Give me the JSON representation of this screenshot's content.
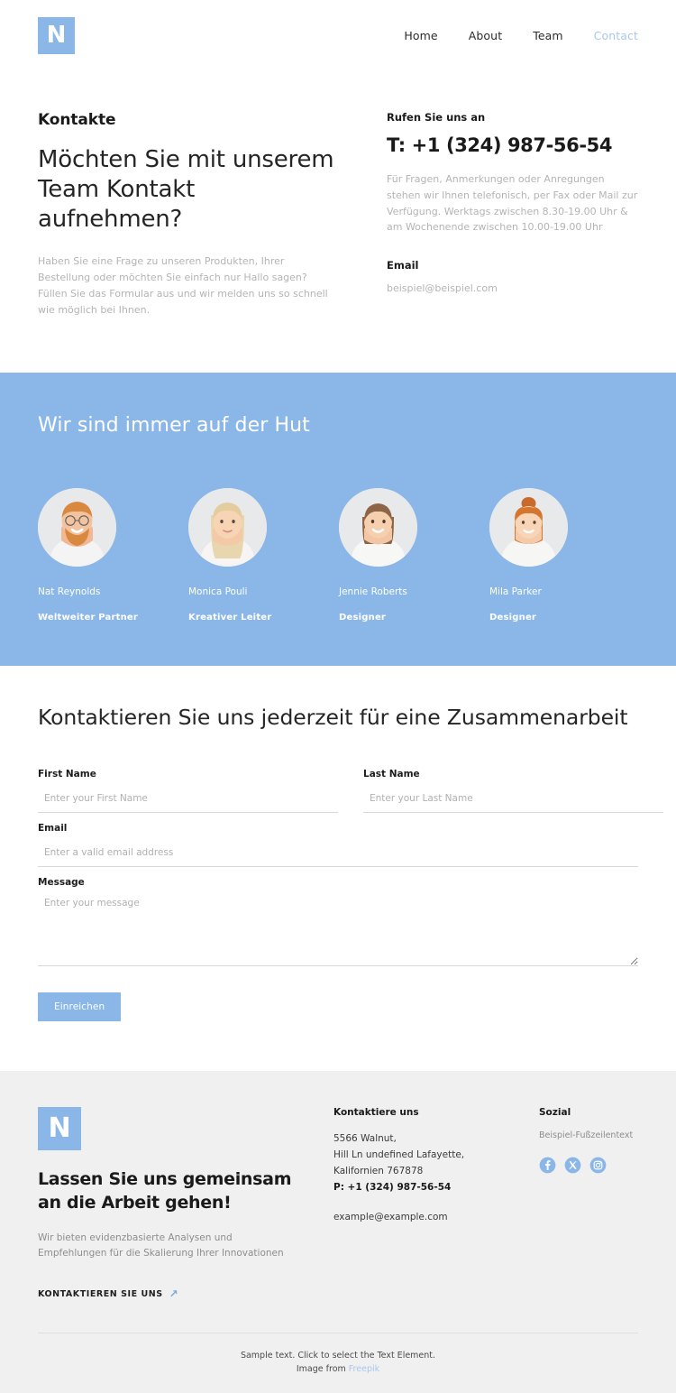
{
  "theme": {
    "accent": "#8ab7e8",
    "accent_light": "#a8c9ec",
    "footer_bg": "#f0f0f0",
    "muted": "#b4b4b4"
  },
  "header": {
    "logo_letter": "N",
    "nav": [
      {
        "label": "Home",
        "active": false
      },
      {
        "label": "About",
        "active": false
      },
      {
        "label": "Team",
        "active": false
      },
      {
        "label": "Contact",
        "active": true
      }
    ]
  },
  "intro": {
    "eyebrow": "Kontakte",
    "heading": "Möchten Sie mit unserem Team Kontakt aufnehmen?",
    "paragraph": "Haben Sie eine Frage zu unseren Produkten, Ihrer Bestellung oder möchten Sie einfach nur Hallo sagen? Füllen Sie das Formular aus und wir melden uns so schnell wie möglich bei Ihnen.",
    "call_label": "Rufen Sie uns an",
    "phone": "T: +1 (324) 987-56-54",
    "hours": "Für Fragen, Anmerkungen oder Anregungen stehen wir Ihnen telefonisch, per Fax oder Mail zur Verfügung. Werktags zwischen 8.30-19.00 Uhr & am Wochenende zwischen 10.00-19.00 Uhr",
    "email_label": "Email",
    "email": "beispiel@beispiel.com"
  },
  "team": {
    "title": "Wir sind immer auf der Hut",
    "members": [
      {
        "name": "Nat Reynolds",
        "role": "Weltweiter Partner"
      },
      {
        "name": "Monica Pouli",
        "role": "Kreativer Leiter"
      },
      {
        "name": "Jennie Roberts",
        "role": "Designer"
      },
      {
        "name": "Mila Parker",
        "role": "Designer"
      }
    ]
  },
  "form": {
    "title": "Kontaktieren Sie uns jederzeit für eine Zusammenarbeit",
    "first_name_label": "First Name",
    "first_name_placeholder": "Enter your First Name",
    "first_name_value": "",
    "last_name_label": "Last Name",
    "last_name_placeholder": "Enter your Last Name",
    "last_name_value": "",
    "email_label": "Email",
    "email_placeholder": "Enter a valid email address",
    "email_value": "",
    "message_label": "Message",
    "message_placeholder": "Enter your message",
    "message_value": "",
    "submit_label": "Einreichen"
  },
  "footer": {
    "logo_letter": "N",
    "heading": "Lassen Sie uns gemeinsam an die Arbeit gehen!",
    "subtext": "Wir bieten evidenzbasierte Analysen und Empfehlungen für die Skalierung Ihrer Innovationen",
    "cta_label": "KONTAKTIEREN SIE UNS",
    "contact_heading": "Kontaktiere uns",
    "address_lines": [
      "5566 Walnut,",
      "Hill Ln undefined Lafayette,",
      "Kalifornien 767878"
    ],
    "phone": "P: +1 (324) 987-56-54",
    "email": "example@example.com",
    "social_heading": "Sozial",
    "social_note": "Beispiel-Fußzeilentext",
    "social_icons": [
      "facebook-icon",
      "x-twitter-icon",
      "instagram-icon"
    ],
    "bottom_line1": "Sample text. Click to select the Text Element.",
    "bottom_line2_prefix": "Image from ",
    "bottom_line2_link": "Freepik"
  }
}
